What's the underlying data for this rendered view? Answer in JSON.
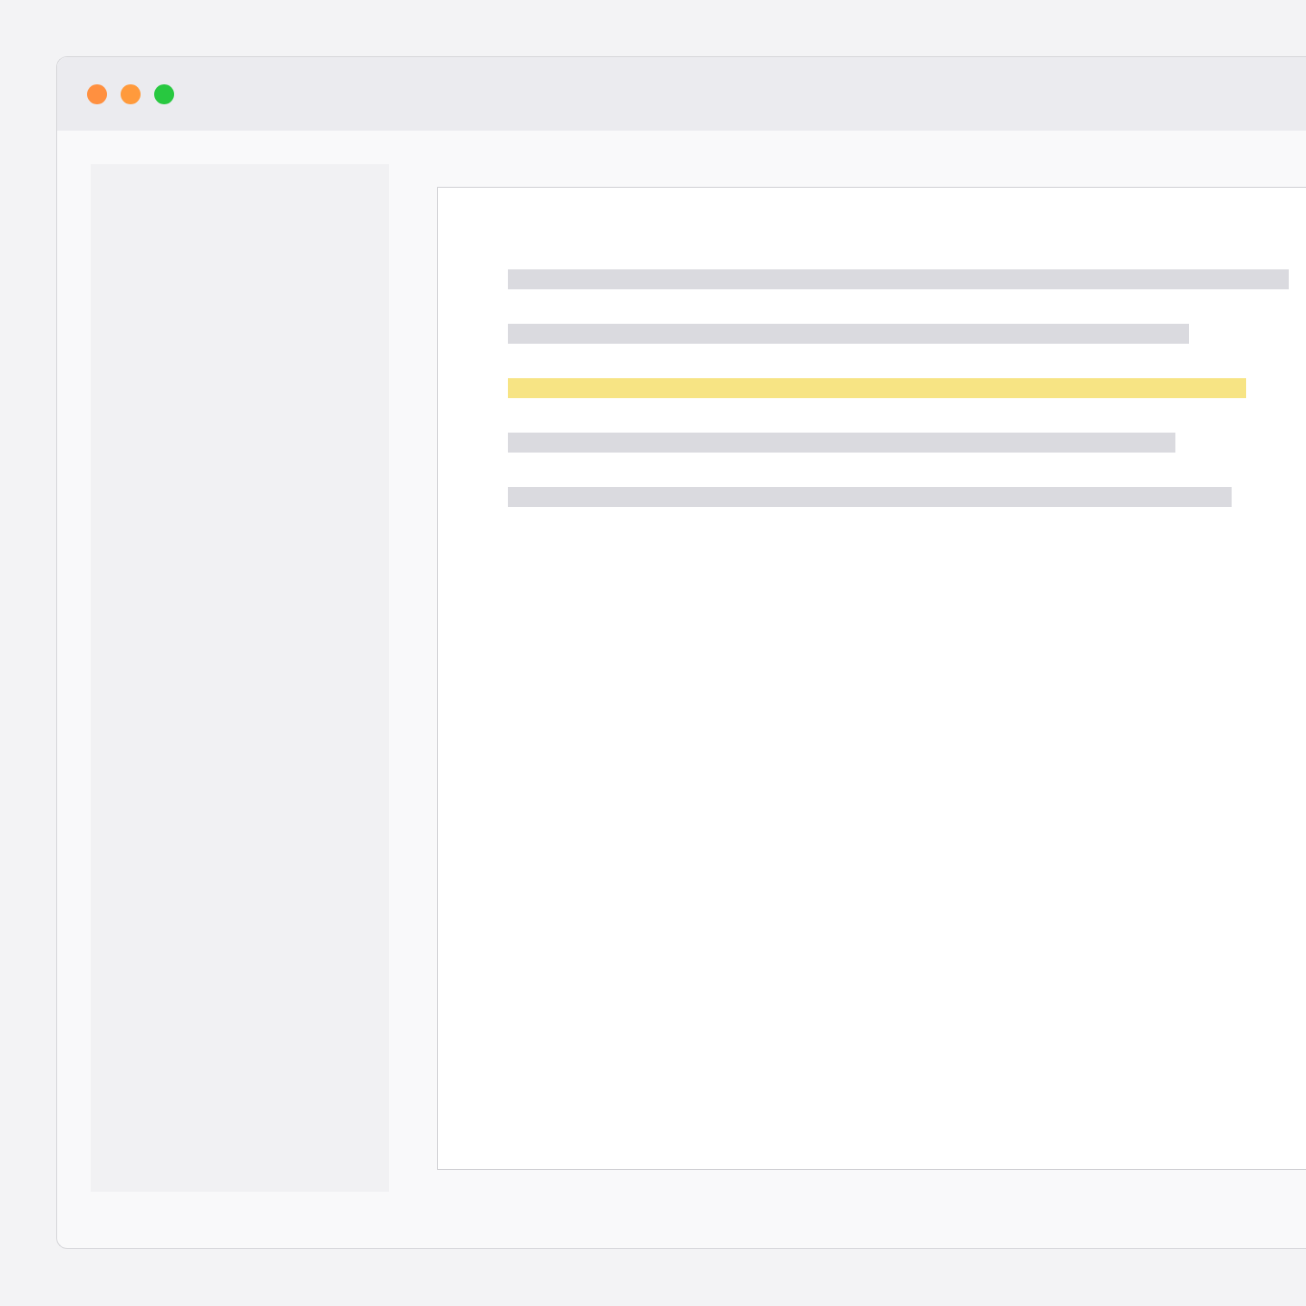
{
  "window": {
    "controls": [
      {
        "color": "#ff9040"
      },
      {
        "color": "#ff9a3c"
      },
      {
        "color": "#28c840"
      }
    ]
  },
  "document": {
    "lines": [
      {
        "highlighted": false
      },
      {
        "highlighted": false
      },
      {
        "highlighted": true
      },
      {
        "highlighted": false
      },
      {
        "highlighted": false
      }
    ]
  }
}
